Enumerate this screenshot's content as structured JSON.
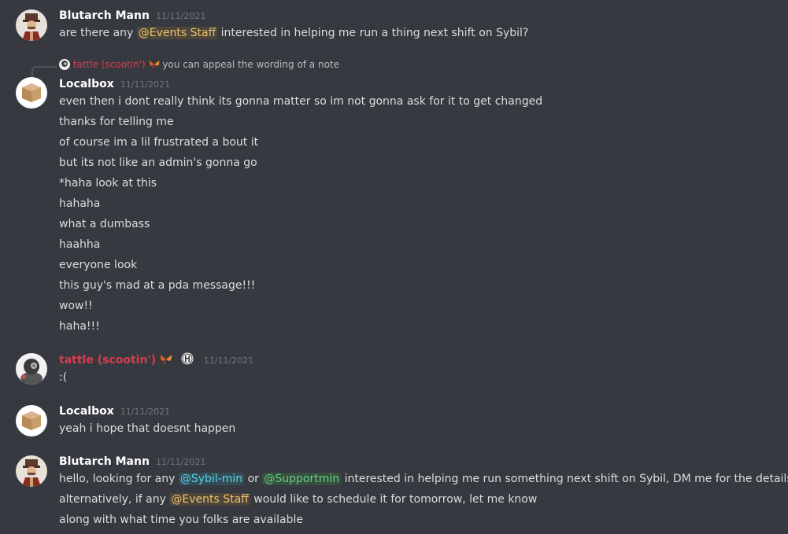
{
  "colors": {
    "background": "#36393f",
    "text": "#dcddde",
    "timestamp": "#72767d",
    "tattle_name": "#d93c4f",
    "mention_events": "#f0c36d",
    "mention_sybil": "#55d2ef",
    "mention_support": "#5fd37c"
  },
  "messages": [
    {
      "author": "Blutarch Mann",
      "timestamp": "11/11/2021",
      "avatar_icon": "hat-man-avatar-icon",
      "line1_pre": "are there any ",
      "line1_mention": "@Events Staff",
      "line1_post": " interested in helping me run a thing next shift on Sybil?"
    },
    {
      "reply_author": "tattle (scootin')",
      "reply_text": "you can appeal the wording of a note",
      "author": "Localbox",
      "timestamp": "11/11/2021",
      "avatar_icon": "box-avatar-icon",
      "lines": [
        "even then i dont really think its gonna matter so im not gonna ask for it to get changed",
        "thanks for telling me",
        "of course im a lil frustrated a bout it",
        "but its not like an admin's gonna go",
        "*haha look at this",
        "hahaha",
        "what a dumbass",
        "haahha",
        "everyone look",
        "this guy's mad at a pda message!!!",
        "wow!!",
        "haha!!!"
      ]
    },
    {
      "author": "tattle (scootin')",
      "timestamp": "11/11/2021",
      "avatar_icon": "robot-avatar-icon",
      "text": ":("
    },
    {
      "author": "Localbox",
      "timestamp": "11/11/2021",
      "avatar_icon": "box-avatar-icon",
      "text": "yeah  i hope that doesnt happen"
    },
    {
      "author": "Blutarch Mann",
      "timestamp": "11/11/2021",
      "avatar_icon": "hat-man-avatar-icon",
      "line1_pre": "hello, looking for any ",
      "line1_mention1": "@Sybil-min",
      "line1_mid": " or ",
      "line1_mention2": "@Supportmin",
      "line1_post": " interested in helping me run something next shift on Sybil, DM me for the details",
      "line2_pre": "alternatively, if any ",
      "line2_mention": "@Events Staff",
      "line2_post": " would like to schedule it for tomorrow, let me know",
      "line3": "along with what time you folks are available"
    }
  ]
}
